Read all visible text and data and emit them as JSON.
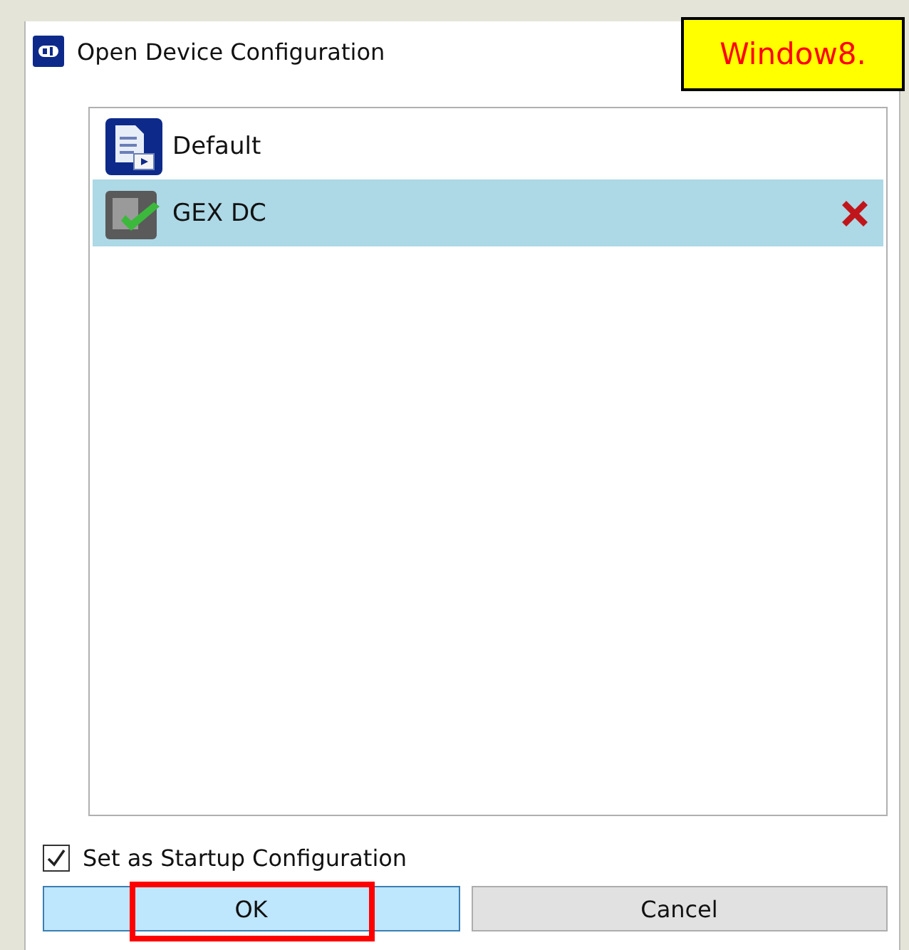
{
  "window": {
    "title": "Open Device Configuration"
  },
  "callout": {
    "text": "Window8."
  },
  "configurations": [
    {
      "name": "Default",
      "kind": "document",
      "selected": false,
      "removable": false
    },
    {
      "name": "GEX DC",
      "kind": "active",
      "selected": true,
      "removable": true
    }
  ],
  "startup_checkbox": {
    "label": "Set as Startup Configuration",
    "checked": true
  },
  "buttons": [
    {
      "label": "OK",
      "highlighted": true,
      "primary": true
    },
    {
      "label": "Cancel",
      "highlighted": false,
      "primary": false
    }
  ]
}
